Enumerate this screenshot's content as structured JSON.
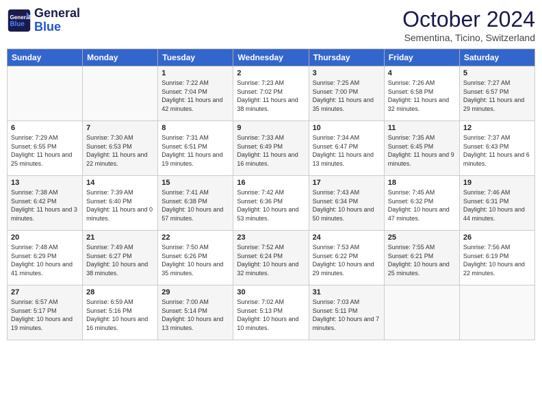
{
  "header": {
    "logo_line1": "General",
    "logo_line2": "Blue",
    "month": "October 2024",
    "location": "Sementina, Ticino, Switzerland"
  },
  "weekdays": [
    "Sunday",
    "Monday",
    "Tuesday",
    "Wednesday",
    "Thursday",
    "Friday",
    "Saturday"
  ],
  "weeks": [
    [
      {
        "day": "",
        "info": ""
      },
      {
        "day": "",
        "info": ""
      },
      {
        "day": "1",
        "info": "Sunrise: 7:22 AM\nSunset: 7:04 PM\nDaylight: 11 hours and 42 minutes."
      },
      {
        "day": "2",
        "info": "Sunrise: 7:23 AM\nSunset: 7:02 PM\nDaylight: 11 hours and 38 minutes."
      },
      {
        "day": "3",
        "info": "Sunrise: 7:25 AM\nSunset: 7:00 PM\nDaylight: 11 hours and 35 minutes."
      },
      {
        "day": "4",
        "info": "Sunrise: 7:26 AM\nSunset: 6:58 PM\nDaylight: 11 hours and 32 minutes."
      },
      {
        "day": "5",
        "info": "Sunrise: 7:27 AM\nSunset: 6:57 PM\nDaylight: 11 hours and 29 minutes."
      }
    ],
    [
      {
        "day": "6",
        "info": "Sunrise: 7:29 AM\nSunset: 6:55 PM\nDaylight: 11 hours and 25 minutes."
      },
      {
        "day": "7",
        "info": "Sunrise: 7:30 AM\nSunset: 6:53 PM\nDaylight: 11 hours and 22 minutes."
      },
      {
        "day": "8",
        "info": "Sunrise: 7:31 AM\nSunset: 6:51 PM\nDaylight: 11 hours and 19 minutes."
      },
      {
        "day": "9",
        "info": "Sunrise: 7:33 AM\nSunset: 6:49 PM\nDaylight: 11 hours and 16 minutes."
      },
      {
        "day": "10",
        "info": "Sunrise: 7:34 AM\nSunset: 6:47 PM\nDaylight: 11 hours and 13 minutes."
      },
      {
        "day": "11",
        "info": "Sunrise: 7:35 AM\nSunset: 6:45 PM\nDaylight: 11 hours and 9 minutes."
      },
      {
        "day": "12",
        "info": "Sunrise: 7:37 AM\nSunset: 6:43 PM\nDaylight: 11 hours and 6 minutes."
      }
    ],
    [
      {
        "day": "13",
        "info": "Sunrise: 7:38 AM\nSunset: 6:42 PM\nDaylight: 11 hours and 3 minutes."
      },
      {
        "day": "14",
        "info": "Sunrise: 7:39 AM\nSunset: 6:40 PM\nDaylight: 11 hours and 0 minutes."
      },
      {
        "day": "15",
        "info": "Sunrise: 7:41 AM\nSunset: 6:38 PM\nDaylight: 10 hours and 57 minutes."
      },
      {
        "day": "16",
        "info": "Sunrise: 7:42 AM\nSunset: 6:36 PM\nDaylight: 10 hours and 53 minutes."
      },
      {
        "day": "17",
        "info": "Sunrise: 7:43 AM\nSunset: 6:34 PM\nDaylight: 10 hours and 50 minutes."
      },
      {
        "day": "18",
        "info": "Sunrise: 7:45 AM\nSunset: 6:32 PM\nDaylight: 10 hours and 47 minutes."
      },
      {
        "day": "19",
        "info": "Sunrise: 7:46 AM\nSunset: 6:31 PM\nDaylight: 10 hours and 44 minutes."
      }
    ],
    [
      {
        "day": "20",
        "info": "Sunrise: 7:48 AM\nSunset: 6:29 PM\nDaylight: 10 hours and 41 minutes."
      },
      {
        "day": "21",
        "info": "Sunrise: 7:49 AM\nSunset: 6:27 PM\nDaylight: 10 hours and 38 minutes."
      },
      {
        "day": "22",
        "info": "Sunrise: 7:50 AM\nSunset: 6:26 PM\nDaylight: 10 hours and 35 minutes."
      },
      {
        "day": "23",
        "info": "Sunrise: 7:52 AM\nSunset: 6:24 PM\nDaylight: 10 hours and 32 minutes."
      },
      {
        "day": "24",
        "info": "Sunrise: 7:53 AM\nSunset: 6:22 PM\nDaylight: 10 hours and 29 minutes."
      },
      {
        "day": "25",
        "info": "Sunrise: 7:55 AM\nSunset: 6:21 PM\nDaylight: 10 hours and 25 minutes."
      },
      {
        "day": "26",
        "info": "Sunrise: 7:56 AM\nSunset: 6:19 PM\nDaylight: 10 hours and 22 minutes."
      }
    ],
    [
      {
        "day": "27",
        "info": "Sunrise: 6:57 AM\nSunset: 5:17 PM\nDaylight: 10 hours and 19 minutes."
      },
      {
        "day": "28",
        "info": "Sunrise: 6:59 AM\nSunset: 5:16 PM\nDaylight: 10 hours and 16 minutes."
      },
      {
        "day": "29",
        "info": "Sunrise: 7:00 AM\nSunset: 5:14 PM\nDaylight: 10 hours and 13 minutes."
      },
      {
        "day": "30",
        "info": "Sunrise: 7:02 AM\nSunset: 5:13 PM\nDaylight: 10 hours and 10 minutes."
      },
      {
        "day": "31",
        "info": "Sunrise: 7:03 AM\nSunset: 5:11 PM\nDaylight: 10 hours and 7 minutes."
      },
      {
        "day": "",
        "info": ""
      },
      {
        "day": "",
        "info": ""
      }
    ]
  ]
}
